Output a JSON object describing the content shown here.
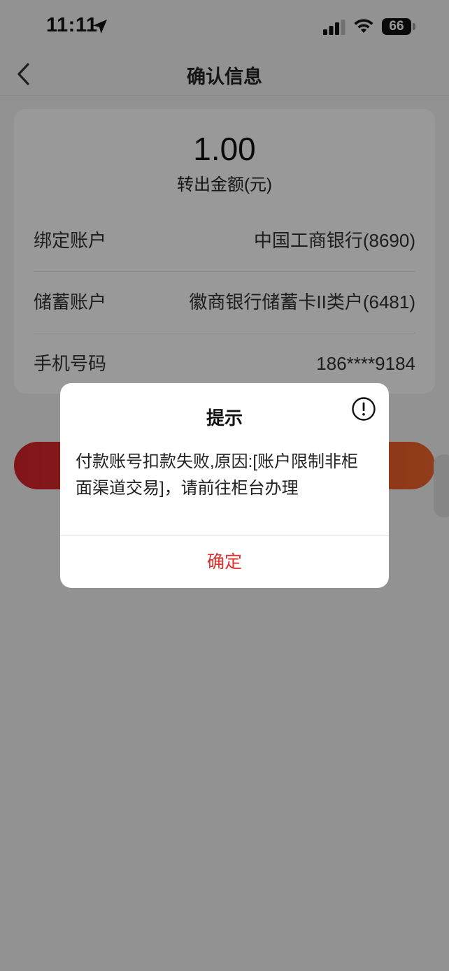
{
  "status_bar": {
    "time": "11:11",
    "battery": "66",
    "icons": [
      "location-arrow-icon",
      "cellular-signal-icon",
      "wifi-icon",
      "battery-icon"
    ]
  },
  "nav": {
    "title": "确认信息",
    "back_icon": "chevron-left-icon"
  },
  "transfer": {
    "amount": "1.00",
    "amount_label": "转出金额(元)",
    "rows": [
      {
        "label": "绑定账户",
        "value": "中国工商银行(8690)"
      },
      {
        "label": "储蓄账户",
        "value": "徽商银行储蓄卡II类户(6481)"
      },
      {
        "label": "手机号码",
        "value": "186****9184"
      }
    ]
  },
  "dialog": {
    "title": "提示",
    "icon": "info-circle-icon",
    "message": "付款账号扣款失败,原因:[账户限制非柜面渠道交易]，请前往柜台办理",
    "ok_label": "确定"
  },
  "colors": {
    "accent": "#e0302a",
    "button_gradient_start": "#d8222a",
    "button_gradient_end": "#f2652c",
    "overlay": "rgba(0,0,0,0.40)"
  }
}
